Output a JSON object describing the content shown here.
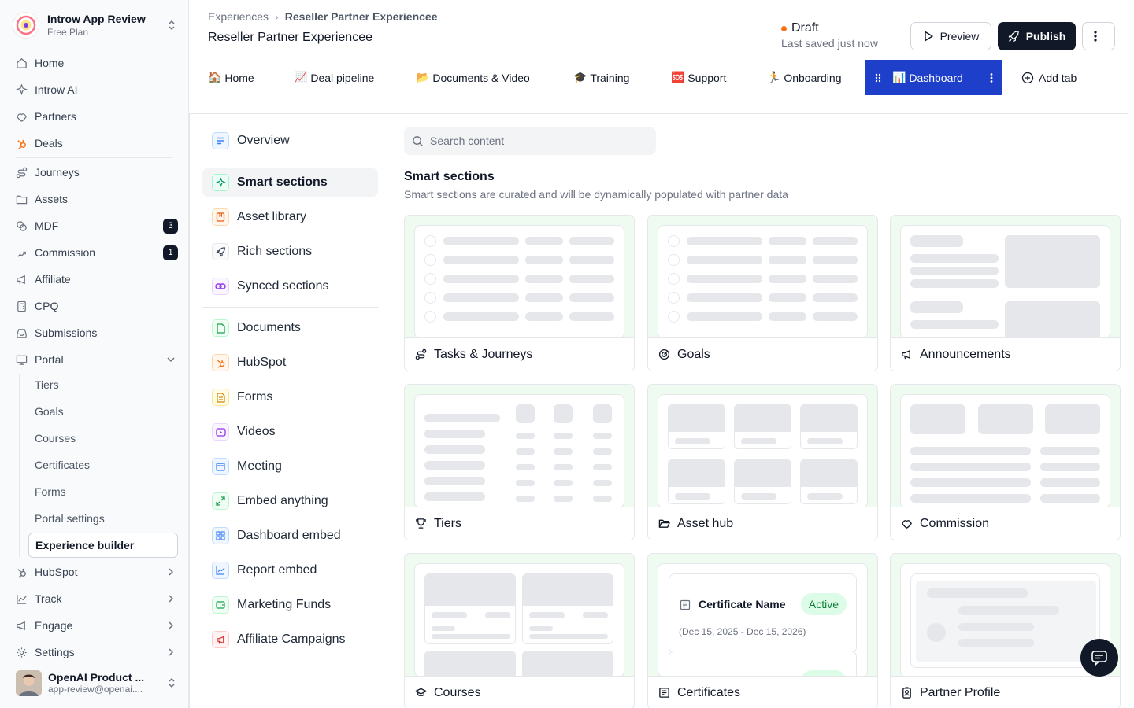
{
  "workspace": {
    "name": "Introw App Review",
    "plan": "Free Plan"
  },
  "sidebar": {
    "nav": [
      {
        "label": "Home"
      },
      {
        "label": "Introw AI"
      },
      {
        "label": "Partners"
      },
      {
        "label": "Deals"
      },
      {
        "label": "Journeys"
      },
      {
        "label": "Assets"
      },
      {
        "label": "MDF",
        "badge": "3"
      },
      {
        "label": "Commission",
        "badge": "1"
      },
      {
        "label": "Affiliate"
      },
      {
        "label": "CPQ"
      },
      {
        "label": "Submissions"
      },
      {
        "label": "Portal"
      }
    ],
    "portal_sub": [
      "Tiers",
      "Goals",
      "Courses",
      "Certificates",
      "Forms",
      "Portal settings",
      "Experience builder"
    ],
    "bottom": [
      "HubSpot",
      "Track",
      "Engage",
      "Settings"
    ]
  },
  "user": {
    "name": "OpenAI Product ...",
    "email": "app-review@openai...."
  },
  "breadcrumb": {
    "parent": "Experiences",
    "current": "Reseller Partner Experiencee"
  },
  "page_title": "Reseller Partner Experiencee",
  "status": {
    "state": "Draft",
    "saved": "Last saved just now",
    "dot_color": "#f97316"
  },
  "actions": {
    "preview": "Preview",
    "publish": "Publish"
  },
  "tabs": [
    {
      "emoji": "🏠",
      "label": "Home"
    },
    {
      "emoji": "📈",
      "label": "Deal pipeline"
    },
    {
      "emoji": "📂",
      "label": "Documents & Video"
    },
    {
      "emoji": "🎓",
      "label": "Training"
    },
    {
      "emoji": "🆘",
      "label": "Support"
    },
    {
      "emoji": "🏃",
      "label": "Onboarding"
    },
    {
      "emoji": "📊",
      "label": "Dashboard",
      "active": true
    }
  ],
  "add_tab": "Add tab",
  "content_nav": {
    "group1": [
      "Overview",
      "Smart sections",
      "Asset library",
      "Rich sections",
      "Synced sections"
    ],
    "group2": [
      "Documents",
      "HubSpot",
      "Forms",
      "Videos",
      "Meeting",
      "Embed anything",
      "Dashboard embed",
      "Report embed",
      "Marketing Funds",
      "Affiliate Campaigns"
    ]
  },
  "search": {
    "placeholder": "Search content"
  },
  "section": {
    "title": "Smart sections",
    "subtitle": "Smart sections are curated and will be dynamically populated with partner data"
  },
  "cards": [
    "Tasks & Journeys",
    "Goals",
    "Announcements",
    "Tiers",
    "Asset hub",
    "Commission",
    "Courses",
    "Certificates",
    "Partner Profile"
  ],
  "certificate_preview": {
    "name": "Certificate Name",
    "status": "Active",
    "dates": "(Dec 15, 2025 - Dec 15, 2026)"
  },
  "colors": {
    "accent": "#1d3fc9",
    "primary_button": "#111827",
    "card_bg": "#effbf1"
  }
}
